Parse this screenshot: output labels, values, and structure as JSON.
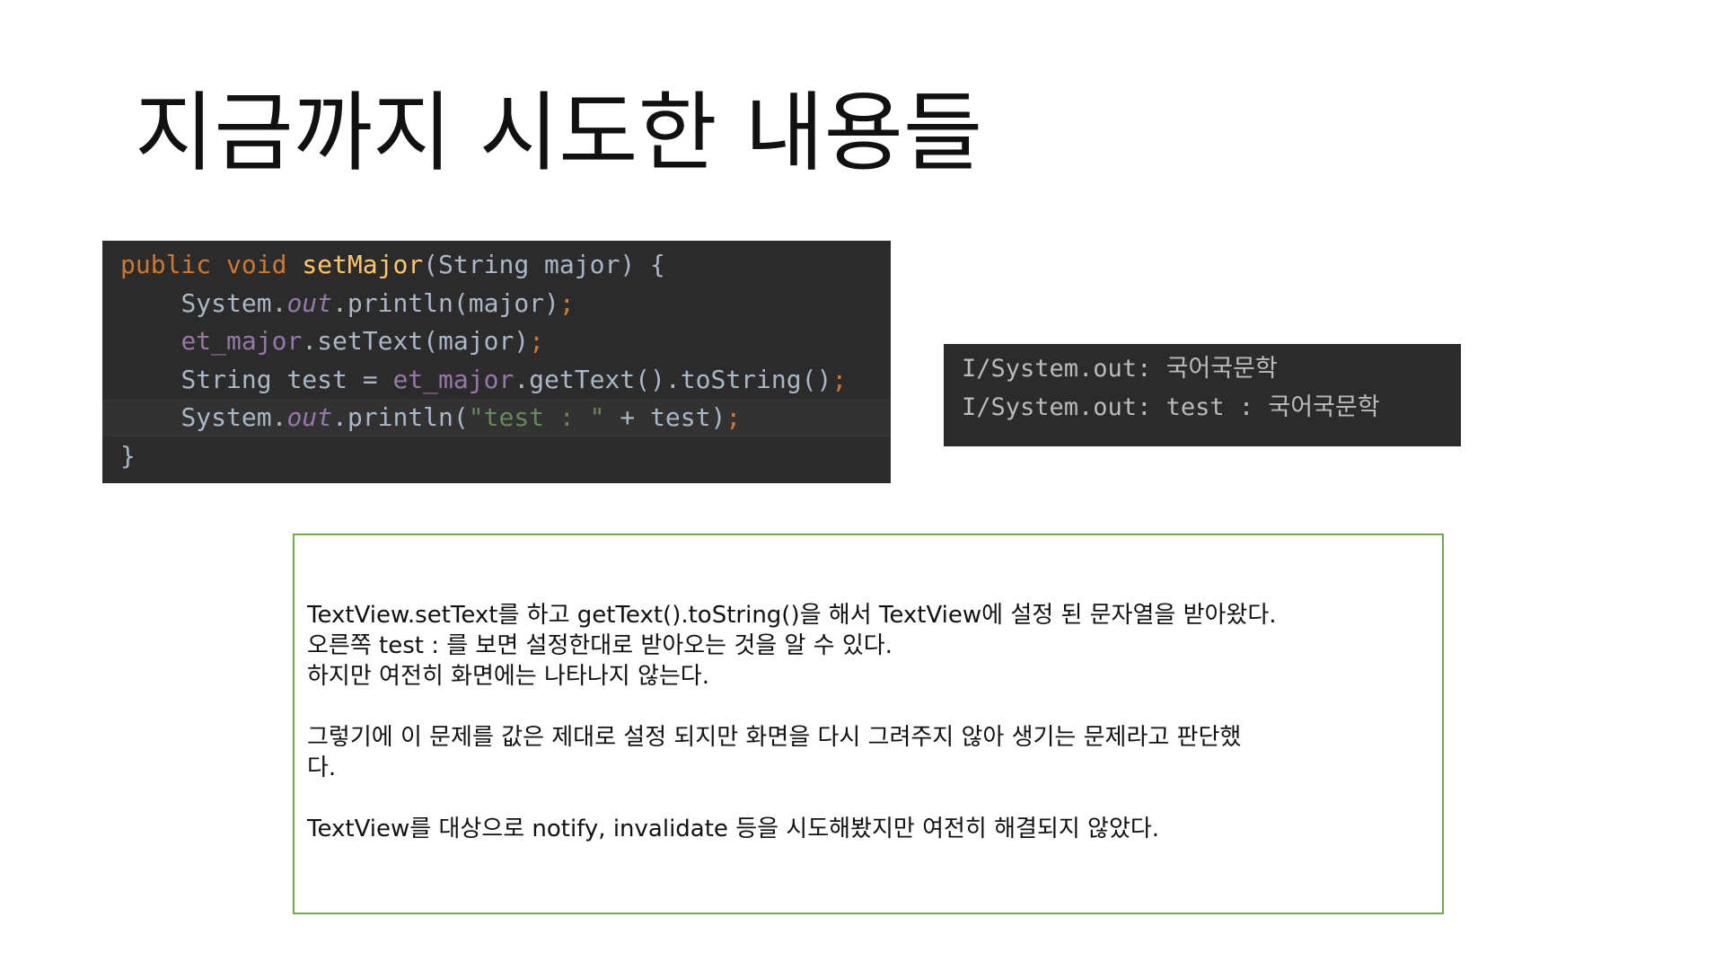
{
  "slide": {
    "title": "지금까지 시도한 내용들"
  },
  "code": {
    "line1": {
      "kw_public": "public",
      "kw_void": "void",
      "method": "setMajor",
      "rest": "(String major) {"
    },
    "line2": {
      "indent": "    ",
      "obj": "System.",
      "field": "out",
      "call": ".println(major)",
      "semi": ";"
    },
    "line3": {
      "indent": "    ",
      "field": "et_major",
      "call": ".setText(major)",
      "semi": ";"
    },
    "line4": {
      "indent": "    ",
      "decl": "String test = ",
      "field": "et_major",
      "call": ".getText().toString()",
      "semi": ";"
    },
    "line5": {
      "indent": "    ",
      "obj": "System.",
      "field": "out",
      "call_open": ".println(",
      "string": "\"test : \"",
      "concat": " + test)",
      "semi": ";"
    },
    "line6": {
      "close": "}"
    }
  },
  "console": {
    "lines": [
      "I/System.out: 국어국문학",
      "I/System.out: test : 국어국문학"
    ]
  },
  "note": {
    "paragraph1": [
      "TextView.setText를 하고 getText().toString()을 해서 TextView에 설정 된 문자열을 받아왔다.",
      "오른쪽 test : 를 보면 설정한대로 받아오는 것을 알 수 있다.",
      "하지만 여전히 화면에는 나타나지 않는다."
    ],
    "paragraph2": [
      "그렇기에 이 문제를 값은 제대로 설정 되지만 화면을 다시 그려주지 않아 생기는 문제라고 판단했",
      "다."
    ],
    "paragraph3": [
      "TextView를 대상으로 notify, invalidate 등을 시도해봤지만 여전히 해결되지 않았다."
    ]
  },
  "colors": {
    "code_background": "#2b2b2b",
    "keyword": "#cc7832",
    "method": "#ffc66d",
    "field": "#9876aa",
    "string": "#6a8759",
    "note_border": "#70ad47"
  }
}
